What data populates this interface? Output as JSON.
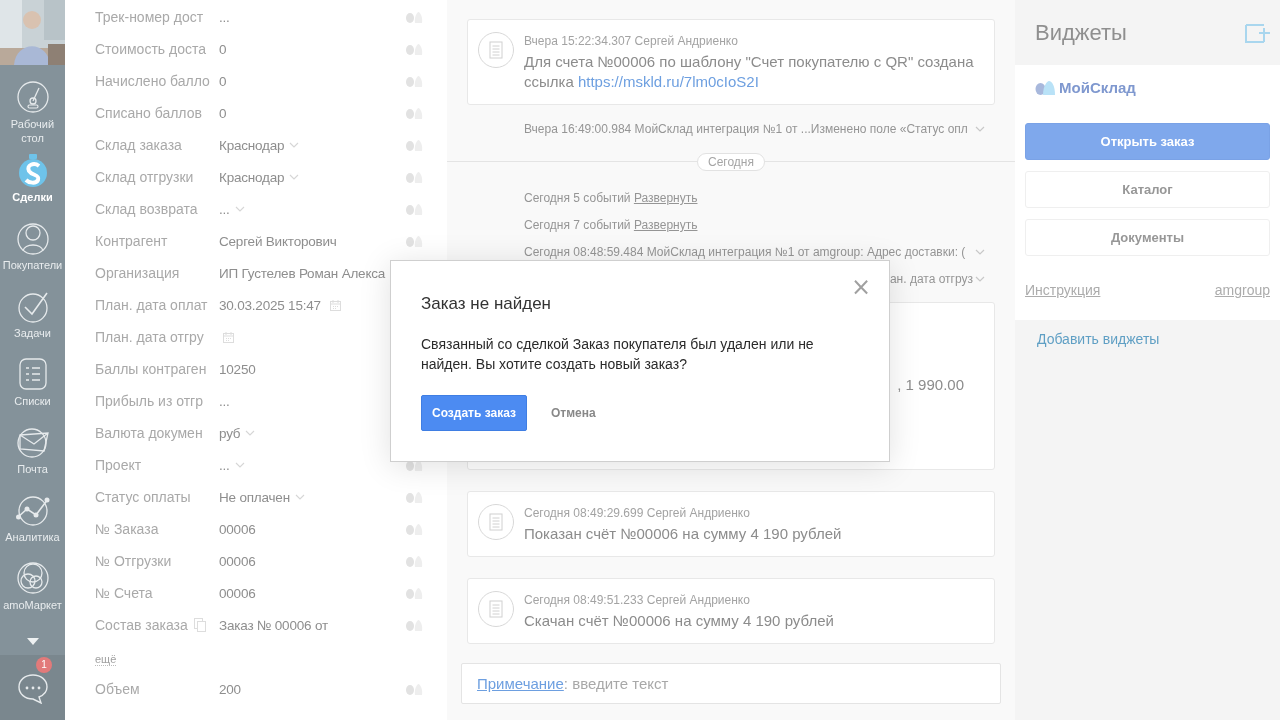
{
  "sidebar": {
    "items": [
      {
        "label": "Рабочий стол",
        "selected": false
      },
      {
        "label": "Сделки",
        "selected": true
      },
      {
        "label": "Покупатели",
        "selected": false
      },
      {
        "label": "Задачи",
        "selected": false
      },
      {
        "label": "Списки",
        "selected": false
      },
      {
        "label": "Почта",
        "selected": false
      },
      {
        "label": "Аналитика",
        "selected": false
      },
      {
        "label": "amoМаркет",
        "selected": false
      }
    ],
    "chat_badge": "1"
  },
  "fields": [
    {
      "label": "Трек-номер дост",
      "value": "...",
      "kind": "text"
    },
    {
      "label": "Стоимость доста",
      "value": "0",
      "kind": "text"
    },
    {
      "label": "Начислено балло",
      "value": "0",
      "kind": "text"
    },
    {
      "label": "Списано баллов",
      "value": "0",
      "kind": "text"
    },
    {
      "label": "Склад заказа",
      "value": "Краснодар",
      "kind": "select"
    },
    {
      "label": "Склад отгрузки",
      "value": "Краснодар",
      "kind": "select"
    },
    {
      "label": "Склад возврата",
      "value": "...",
      "kind": "select"
    },
    {
      "label": "Контрагент",
      "value": "Сергей Викторович",
      "kind": "text"
    },
    {
      "label": "Организация",
      "value": "ИП Густелев Роман Алекса",
      "kind": "text"
    },
    {
      "label": "План. дата оплат",
      "value": "30.03.2025 15:47",
      "kind": "date"
    },
    {
      "label": "План. дата отгру",
      "kind": "date"
    },
    {
      "label": "Баллы контраген",
      "value": "10250",
      "kind": "text"
    },
    {
      "label": "Прибыль из отгр",
      "value": "...",
      "kind": "text"
    },
    {
      "label": "Валюта докумен",
      "value": "руб",
      "kind": "select"
    },
    {
      "label": "Проект",
      "value": "...",
      "kind": "select"
    },
    {
      "label": "Статус оплаты",
      "value": "Не оплачен",
      "kind": "select"
    },
    {
      "label": "№ Заказа",
      "value": "00006",
      "kind": "text"
    },
    {
      "label": "№ Отгрузки",
      "value": "00006",
      "kind": "text"
    },
    {
      "label": "№ Счета",
      "value": "00006",
      "kind": "text"
    },
    {
      "label": "Состав заказа",
      "value": "Заказ № 00006 от",
      "kind": "copy"
    },
    {
      "label": "ещё",
      "kind": "more"
    },
    {
      "label": "Объем",
      "value": "200",
      "kind": "text"
    }
  ],
  "feed": [
    {
      "kind": "card",
      "meta": "Вчера 15:22:34.307 Сергей Андриенко",
      "text": "Для счета №00006 по шаблону \"Счет покупателю с QR\" создана ссылка ",
      "link": "https://mskld.ru/7lm0cIoS2I"
    },
    {
      "kind": "event",
      "text": "Вчера 16:49:00.984 МойСклад интеграция №1 от ...Изменено поле «Статус опл"
    },
    {
      "kind": "date",
      "text": "Сегодня"
    },
    {
      "kind": "group",
      "text": "Сегодня 5 событий ",
      "link": "Развернуть"
    },
    {
      "kind": "group",
      "text": "Сегодня 7 событий ",
      "link": "Развернуть"
    },
    {
      "kind": "event",
      "text": "Сегодня 08:48:59.484 МойСклад интеграция №1 от amgroup: Адрес доставки: ("
    },
    {
      "kind": "event_tail",
      "text": "ан. дата отгруз"
    },
    {
      "kind": "card_tail",
      "text": ", 1 990.00"
    },
    {
      "kind": "card",
      "meta": "Сегодня 08:49:29.699 Сергей Андриенко",
      "text": "Показан счёт №00006 на сумму 4 190 рублей"
    },
    {
      "kind": "card",
      "meta": "Сегодня 08:49:51.233 Сергей Андриенко",
      "text": "Скачан счёт №00006 на сумму 4 190 рублей"
    }
  ],
  "note": {
    "label": "Примечание",
    "separator": ": ",
    "placeholder": "введите текст"
  },
  "widgets": {
    "title": "Виджеты",
    "logo": "МойСклад",
    "buttons": [
      {
        "label": "Открыть заказ",
        "kind": "primary"
      },
      {
        "label": "Каталог",
        "kind": "plain"
      },
      {
        "label": "Документы",
        "kind": "plain"
      }
    ],
    "links": [
      "Инструкция",
      "amgroup"
    ],
    "add_link": "Добавить виджеты"
  },
  "dialog": {
    "title": "Заказ не найден",
    "message": "Связанный со сделкой Заказ покупателя был удален или не найден. Вы хотите создать новый заказ?",
    "close": "×",
    "buttons": [
      {
        "label": "Создать заказ",
        "kind": "primary"
      },
      {
        "label": "Отмена",
        "kind": "secondary"
      }
    ]
  }
}
